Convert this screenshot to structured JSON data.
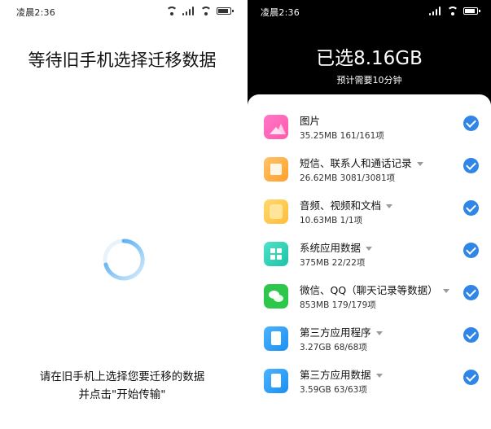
{
  "left_screen": {
    "status_time": "凌晨2:36",
    "title": "等待旧手机选择迁移数据",
    "instruction_line1": "请在旧手机上选择您要迁移的数据",
    "instruction_line2": "并点击\"开始传输\""
  },
  "right_screen": {
    "status_time": "凌晨2:36",
    "selected_total": "已选8.16GB",
    "eta": "预计需要10分钟",
    "items": [
      {
        "name": "图片",
        "size": "35.25MB",
        "count": "161/161项",
        "icon": "photos-icon",
        "has_caret": false,
        "checked": true
      },
      {
        "name": "短信、联系人和通话记录",
        "size": "26.62MB",
        "count": "3081/3081项",
        "icon": "messages-contacts-icon",
        "has_caret": true,
        "checked": true
      },
      {
        "name": "音频、视频和文档",
        "size": "10.63MB",
        "count": "1/1项",
        "icon": "media-documents-icon",
        "has_caret": true,
        "checked": true
      },
      {
        "name": "系统应用数据",
        "size": "375MB",
        "count": "22/22项",
        "icon": "system-apps-icon",
        "has_caret": true,
        "checked": true
      },
      {
        "name": "微信、QQ（聊天记录等数据）",
        "size": "853MB",
        "count": "179/179项",
        "icon": "wechat-icon",
        "has_caret": true,
        "checked": true
      },
      {
        "name": "第三方应用程序",
        "size": "3.27GB",
        "count": "68/68项",
        "icon": "file-icon",
        "has_caret": true,
        "checked": true
      },
      {
        "name": "第三方应用数据",
        "size": "3.59GB",
        "count": "63/63项",
        "icon": "file-icon",
        "has_caret": true,
        "checked": true
      }
    ]
  },
  "colors": {
    "accent_check": "#2f86e6",
    "dark_header": "#000000",
    "spinner": "#3aa0f0"
  }
}
